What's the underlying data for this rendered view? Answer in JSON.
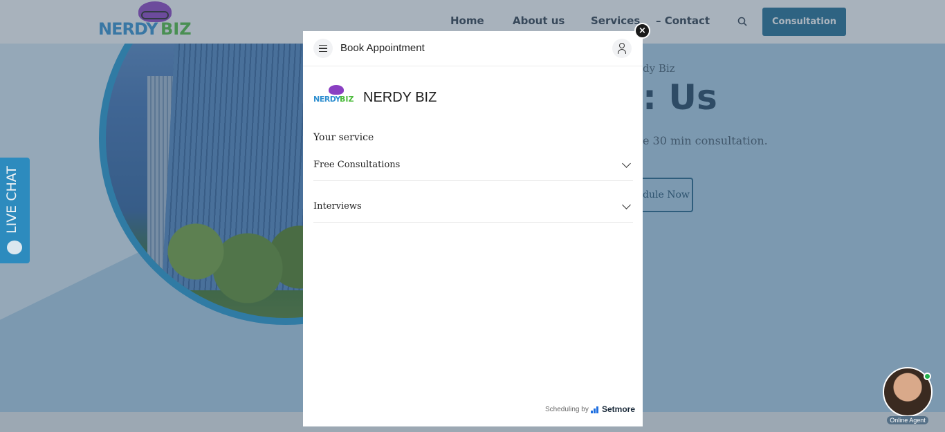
{
  "site": {
    "logo_word1": "NERDY",
    "logo_word2": "BIZ",
    "nav": [
      "Home",
      "About us",
      "Services",
      "– Contact"
    ],
    "consultation_button": "Consultation",
    "hero_kicker": "dy Biz",
    "hero_title": ": Us",
    "hero_sub": "e 30 min consultation.",
    "hero_button": "dule Now"
  },
  "live_chat": {
    "label": "LIVE CHAT"
  },
  "agent": {
    "label": "Online Agent"
  },
  "modal": {
    "title": "Book Appointment",
    "logo_word1": "NERDY",
    "logo_word2": "BIZ",
    "business_name": "NERDY BIZ",
    "section_label": "Your service",
    "services": [
      "Free Consultations",
      "Interviews"
    ],
    "footer_prefix": "Scheduling by",
    "footer_brand": "Setmore",
    "close_glyph": "×"
  },
  "colors": {
    "accent": "#1b6a92",
    "setmore_blue": "#1f6fe0",
    "online_green": "#22b14c"
  }
}
